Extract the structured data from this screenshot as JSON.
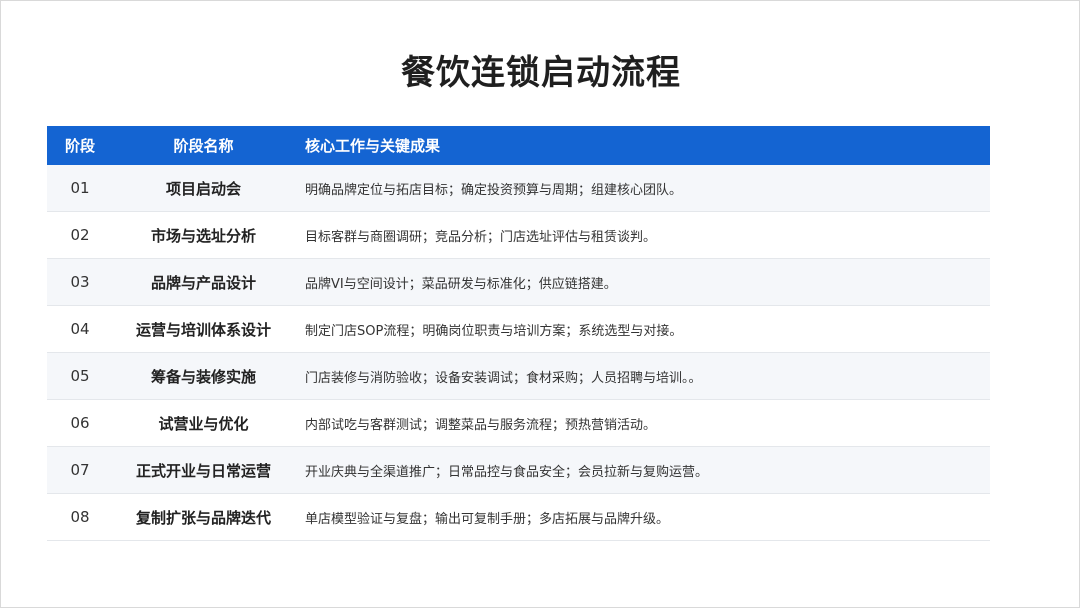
{
  "title": "餐饮连锁启动流程",
  "table": {
    "headers": [
      "阶段",
      "阶段名称",
      "核心工作与关键成果"
    ],
    "rows": [
      {
        "stage": "01",
        "name": "项目启动会",
        "desc": "明确品牌定位与拓店目标；确定投资预算与周期；组建核心团队。"
      },
      {
        "stage": "02",
        "name": "市场与选址分析",
        "desc": "目标客群与商圈调研；竞品分析；门店选址评估与租赁谈判。"
      },
      {
        "stage": "03",
        "name": "品牌与产品设计",
        "desc": "品牌VI与空间设计；菜品研发与标准化；供应链搭建。"
      },
      {
        "stage": "04",
        "name": "运营与培训体系设计",
        "desc": "制定门店SOP流程；明确岗位职责与培训方案；系统选型与对接。"
      },
      {
        "stage": "05",
        "name": "筹备与装修实施",
        "desc": "门店装修与消防验收；设备安装调试；食材采购；人员招聘与培训。。"
      },
      {
        "stage": "06",
        "name": "试营业与优化",
        "desc": "内部试吃与客群测试；调整菜品与服务流程；预热营销活动。"
      },
      {
        "stage": "07",
        "name": "正式开业与日常运营",
        "desc": "开业庆典与全渠道推广；日常品控与食品安全；会员拉新与复购运营。"
      },
      {
        "stage": "08",
        "name": "复制扩张与品牌迭代",
        "desc": "单店模型验证与复盘；输出可复制手册；多店拓展与品牌升级。"
      }
    ]
  },
  "colors": {
    "header_bg": "#1464d2",
    "row_alt_bg": "#f5f7fa"
  }
}
